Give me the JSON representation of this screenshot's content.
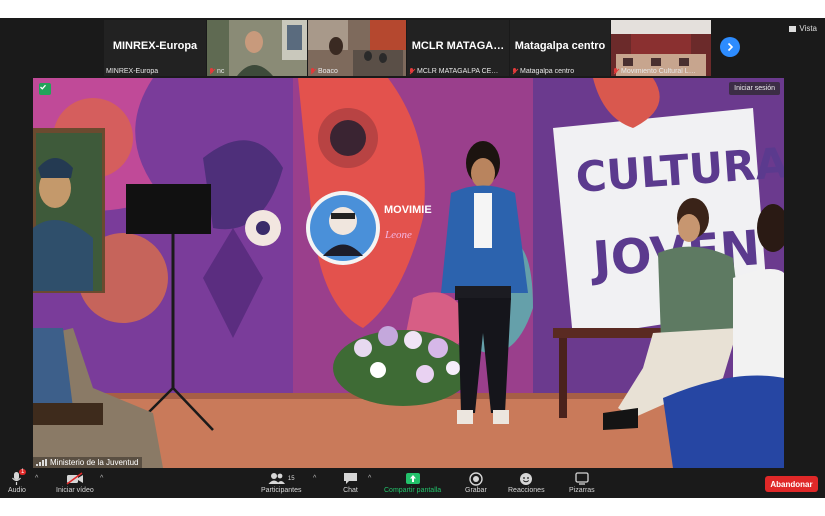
{
  "strip": {
    "tiles": [
      {
        "big": "MINREX-Europa",
        "caption": "MINREX-Europa"
      },
      {
        "big": "",
        "caption": "nc"
      },
      {
        "big": "",
        "caption": "Boaco"
      },
      {
        "big": "MCLR  MATAGA…",
        "caption": "MCLR MATAGALPA CE…"
      },
      {
        "big": "Matagalpa centro",
        "caption": "Matagalpa centro"
      },
      {
        "big": "",
        "caption": "Movimiento Cultural L…"
      }
    ],
    "view_label": "Vista"
  },
  "stage": {
    "login_label": "Iniciar sesión",
    "speaker": "Ministerio de la Juventud",
    "banner_text": [
      "CULTURA",
      "JOVEN"
    ],
    "logo_text": [
      "MOVIMIE",
      "Leone"
    ]
  },
  "toolbar": {
    "audio": "Audio",
    "video": "Iniciar vídeo",
    "participants": "Participantes",
    "participants_count": "15",
    "chat": "Chat",
    "share": "Compartir pantalla",
    "record": "Grabar",
    "reactions": "Reacciones",
    "whiteboards": "Pizarras",
    "leave": "Abandonar",
    "audio_badge": "1"
  },
  "colors": {
    "accent_blue": "#2d8cff",
    "leave_red": "#e02828",
    "share_green": "#23c26b",
    "bar_bg": "#1a1a1a"
  }
}
